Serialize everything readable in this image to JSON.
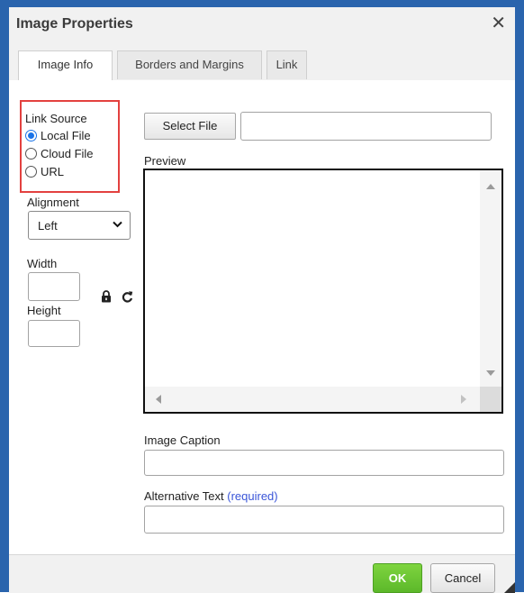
{
  "dialog": {
    "title": "Image Properties",
    "close_glyph": "✕"
  },
  "tabs": [
    {
      "label": "Image Info",
      "active": true
    },
    {
      "label": "Borders and Margins",
      "active": false
    },
    {
      "label": "Link",
      "active": false
    }
  ],
  "link_source": {
    "label": "Link Source",
    "options": [
      {
        "label": "Local File",
        "checked": true
      },
      {
        "label": "Cloud File",
        "checked": false
      },
      {
        "label": "URL",
        "checked": false
      }
    ]
  },
  "alignment": {
    "label": "Alignment",
    "value": "Left"
  },
  "width": {
    "label": "Width",
    "value": ""
  },
  "height": {
    "label": "Height",
    "value": ""
  },
  "icons": {
    "lock": "lock-icon",
    "reset": "reset-icon"
  },
  "file": {
    "select_label": "Select File",
    "path_value": ""
  },
  "preview": {
    "label": "Preview"
  },
  "caption": {
    "label": "Image Caption",
    "value": ""
  },
  "alt_text": {
    "label": "Alternative Text",
    "required_label": "(required)",
    "value": ""
  },
  "footer": {
    "ok_label": "OK",
    "cancel_label": "Cancel"
  },
  "colors": {
    "frame": "#2a64ad",
    "required": "#3a55d8",
    "ok": "#6cc431",
    "highlight_box": "#e3413f"
  }
}
